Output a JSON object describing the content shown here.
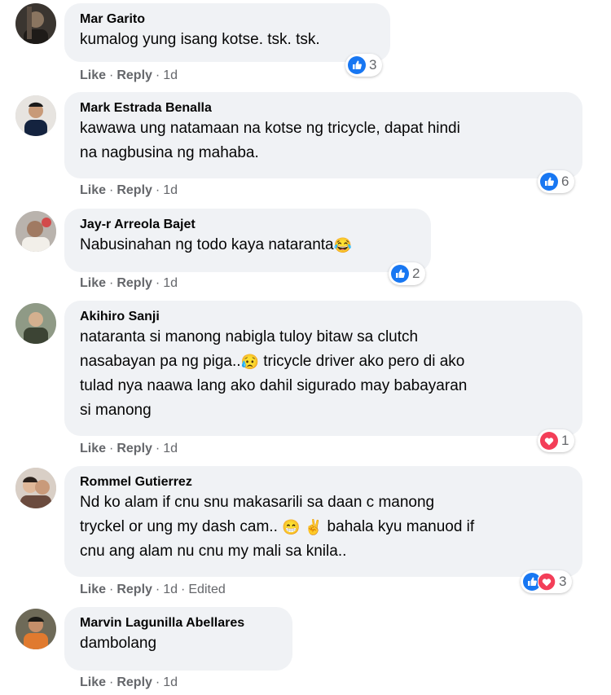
{
  "comments": [
    {
      "author": "Mar Garito",
      "text": "kumalog yung isang kotse. tsk. tsk.",
      "reaction_count": "3",
      "like_label": "Like",
      "reply_label": "Reply",
      "time": "1d"
    },
    {
      "author": "Mark Estrada Benalla",
      "text_line1": "kawawa ung natamaan na kotse ng tricycle, dapat hindi",
      "text_line2": "na nagbusina ng mahaba.",
      "reaction_count": "6",
      "like_label": "Like",
      "reply_label": "Reply",
      "time": "1d"
    },
    {
      "author": "Jay-r Arreola Bajet",
      "text": "Nabusinahan ng todo kaya nataranta",
      "emoji": "😂",
      "reaction_count": "2",
      "like_label": "Like",
      "reply_label": "Reply",
      "time": "1d"
    },
    {
      "author": "Akihiro Sanji",
      "text_line1": "nataranta si manong nabigla tuloy bitaw sa clutch",
      "text_line2a": "nasabayan pa ng piga..",
      "emoji": "😥",
      "text_line2b": " tricycle driver ako pero di ako",
      "text_line3": "tulad nya naawa lang ako dahil sigurado may babayaran",
      "text_line4": "si manong",
      "reaction_count": "1",
      "like_label": "Like",
      "reply_label": "Reply",
      "time": "1d"
    },
    {
      "author": "Rommel Gutierrez",
      "text_line1": "Nd ko alam if cnu snu makasarili sa daan c manong",
      "text_line2a": "tryckel or ung my dash cam.. ",
      "emoji1": "😁",
      "emoji2": "✌",
      "text_line2b": " bahala kyu manuod if",
      "text_line3": "cnu ang alam nu cnu my mali sa knila..",
      "reaction_count": "3",
      "like_label": "Like",
      "reply_label": "Reply",
      "time": "1d",
      "edited_label": "Edited"
    },
    {
      "author": "Marvin Lagunilla Abellares",
      "text": "dambolang",
      "like_label": "Like",
      "reply_label": "Reply",
      "time": "1d"
    }
  ],
  "colors": {
    "bubble": "#f0f2f5",
    "like_blue": "#1877f2",
    "love_red": "#f33e58",
    "muted": "#65676b"
  },
  "icons": {
    "like": "thumbs-up-icon",
    "love": "heart-icon"
  }
}
